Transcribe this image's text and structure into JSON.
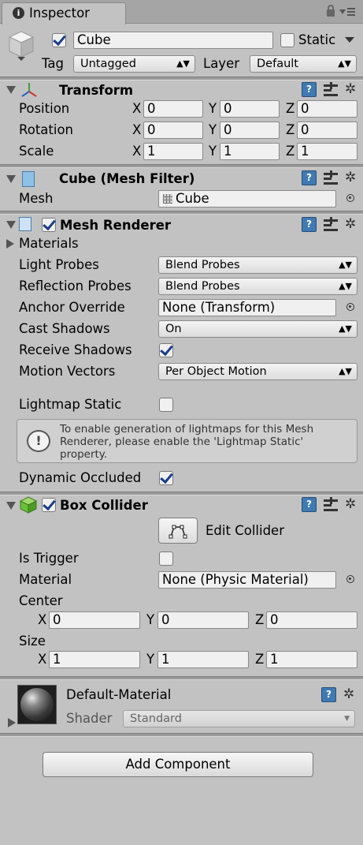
{
  "tab": {
    "icon": "info-icon",
    "label": "Inspector"
  },
  "object": {
    "active": true,
    "name": "Cube",
    "static_label": "Static",
    "static_checked": false,
    "tag_label": "Tag",
    "tag_value": "Untagged",
    "layer_label": "Layer",
    "layer_value": "Default"
  },
  "transform": {
    "title": "Transform",
    "rows": [
      {
        "label": "Position",
        "x": "0",
        "y": "0",
        "z": "0"
      },
      {
        "label": "Rotation",
        "x": "0",
        "y": "0",
        "z": "0"
      },
      {
        "label": "Scale",
        "x": "1",
        "y": "1",
        "z": "1"
      }
    ],
    "axis": {
      "x": "X",
      "y": "Y",
      "z": "Z"
    }
  },
  "mesh_filter": {
    "title": "Cube (Mesh Filter)",
    "mesh_label": "Mesh",
    "mesh_value": "Cube"
  },
  "mesh_renderer": {
    "title": "Mesh Renderer",
    "enabled": true,
    "materials_label": "Materials",
    "light_probes_label": "Light Probes",
    "light_probes_value": "Blend Probes",
    "reflection_probes_label": "Reflection Probes",
    "reflection_probes_value": "Blend Probes",
    "anchor_override_label": "Anchor Override",
    "anchor_override_value": "None (Transform)",
    "cast_shadows_label": "Cast Shadows",
    "cast_shadows_value": "On",
    "receive_shadows_label": "Receive Shadows",
    "receive_shadows_checked": true,
    "motion_vectors_label": "Motion Vectors",
    "motion_vectors_value": "Per Object Motion",
    "lightmap_static_label": "Lightmap Static",
    "lightmap_static_checked": false,
    "info_line1": "To enable generation of lightmaps for this Mesh",
    "info_line2": "Renderer, please enable the 'Lightmap Static'",
    "info_line3": "property.",
    "dynamic_occluded_label": "Dynamic Occluded",
    "dynamic_occluded_checked": true
  },
  "box_collider": {
    "title": "Box Collider",
    "enabled": true,
    "edit_collider_label": "Edit Collider",
    "is_trigger_label": "Is Trigger",
    "is_trigger_checked": false,
    "material_label": "Material",
    "material_value": "None (Physic Material)",
    "center_label": "Center",
    "center": {
      "x": "0",
      "y": "0",
      "z": "0"
    },
    "size_label": "Size",
    "size": {
      "x": "1",
      "y": "1",
      "z": "1"
    }
  },
  "material": {
    "name": "Default-Material",
    "shader_label": "Shader",
    "shader_value": "Standard"
  },
  "add_component_label": "Add Component"
}
